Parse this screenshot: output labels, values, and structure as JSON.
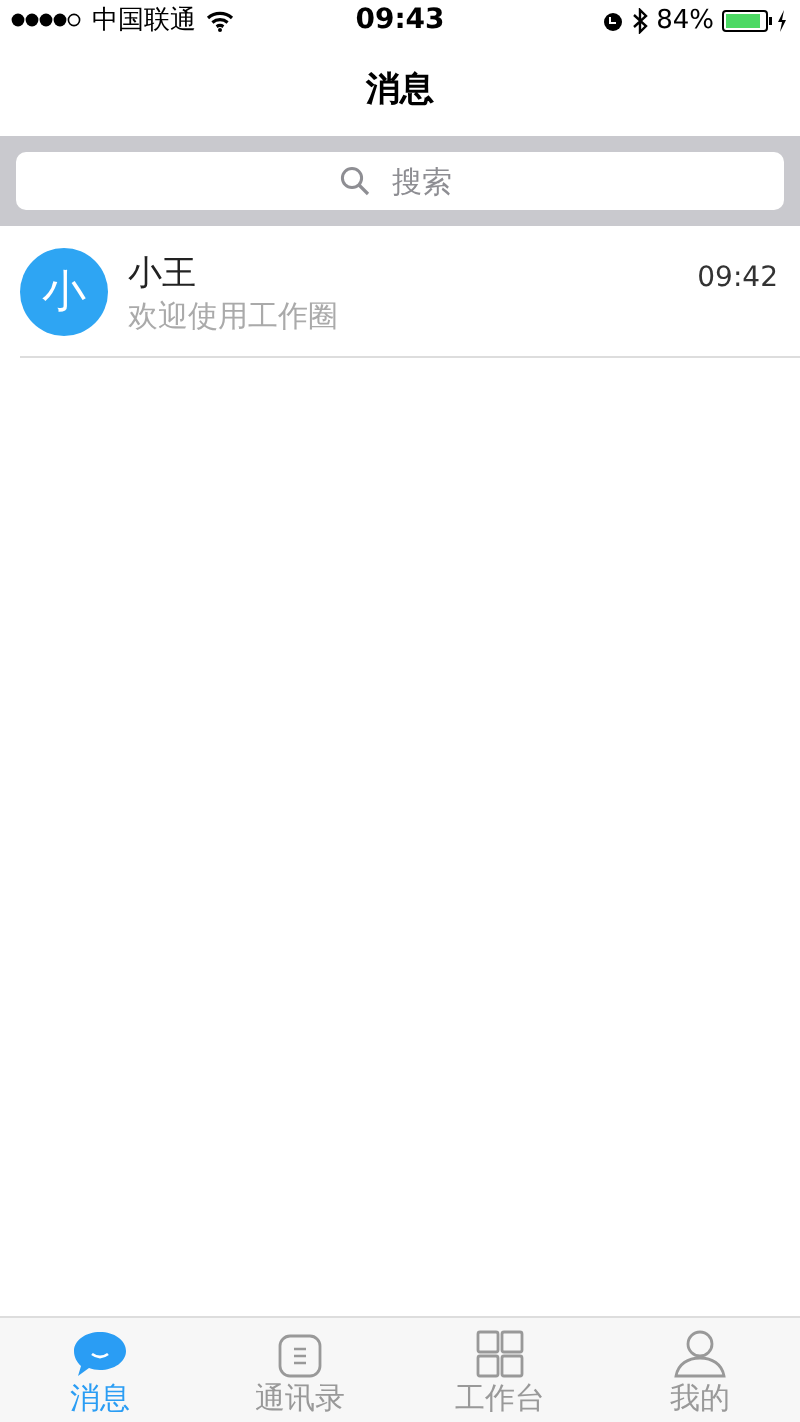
{
  "status_bar": {
    "carrier": "中国联通",
    "time": "09:43",
    "battery": "84%"
  },
  "nav": {
    "title": "消息"
  },
  "search": {
    "placeholder": "搜索"
  },
  "conversations": [
    {
      "avatar": "小",
      "name": "小王",
      "preview": "欢迎使用工作圈",
      "time": "09:42"
    }
  ],
  "tab_bar": [
    {
      "label": "消息",
      "kind": "chat",
      "selected": true
    },
    {
      "label": "通讯录",
      "kind": "contacts",
      "selected": false
    },
    {
      "label": "工作台",
      "kind": "grid",
      "selected": false
    },
    {
      "label": "我的",
      "kind": "person",
      "selected": false
    }
  ]
}
